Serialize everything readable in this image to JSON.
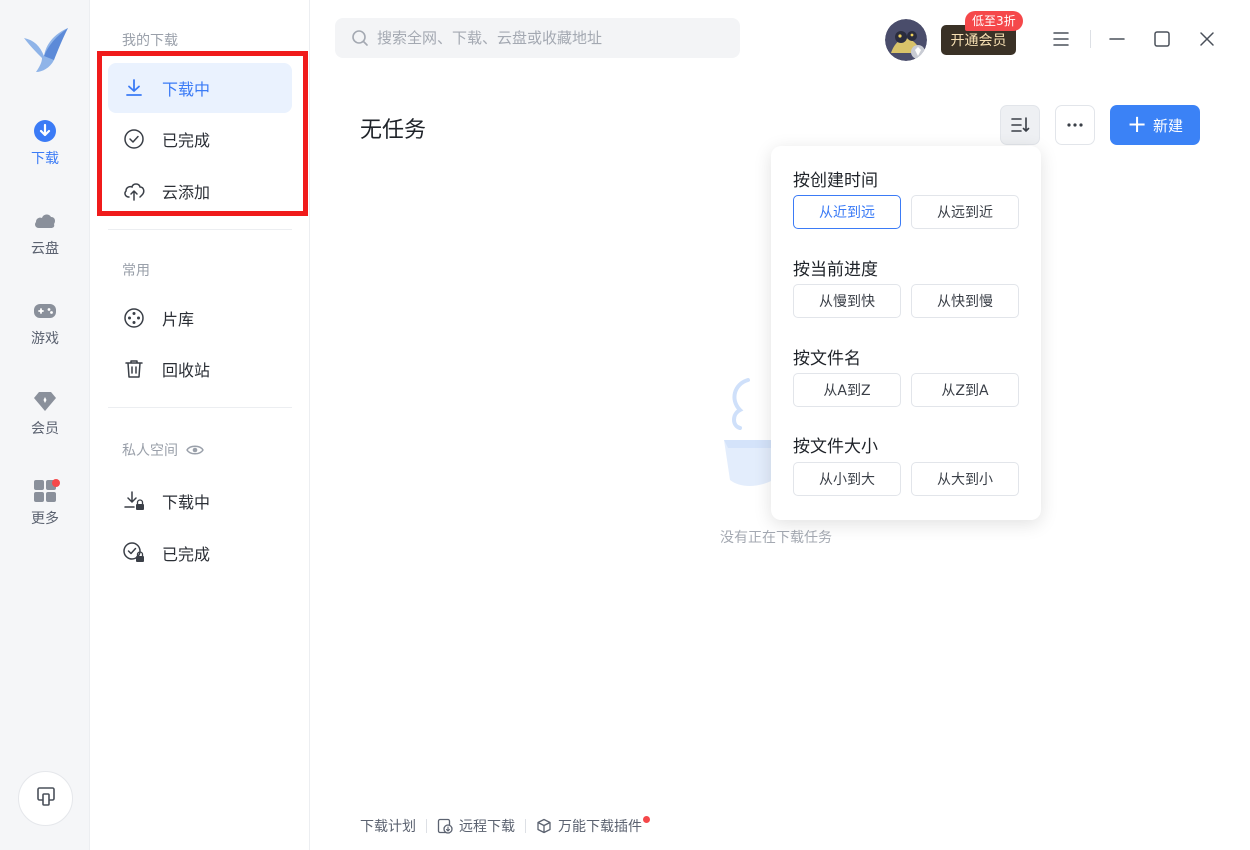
{
  "rail": {
    "items": [
      {
        "label": "下载",
        "icon": "download-circle-icon",
        "active": true
      },
      {
        "label": "云盘",
        "icon": "cloud-icon"
      },
      {
        "label": "游戏",
        "icon": "gamepad-icon"
      },
      {
        "label": "会员",
        "icon": "diamond-icon"
      },
      {
        "label": "更多",
        "icon": "apps-grid-icon"
      }
    ]
  },
  "sidebar": {
    "my_downloads_heading": "我的下载",
    "my_downloads": [
      {
        "label": "下载中",
        "icon": "download-arrow-icon"
      },
      {
        "label": "已完成",
        "icon": "check-circle-icon"
      },
      {
        "label": "云添加",
        "icon": "cloud-upload-icon"
      }
    ],
    "common_heading": "常用",
    "common": [
      {
        "label": "片库",
        "icon": "film-reel-icon"
      },
      {
        "label": "回收站",
        "icon": "trash-icon"
      }
    ],
    "private_heading": "私人空间",
    "private": [
      {
        "label": "下载中",
        "icon": "download-lock-icon"
      },
      {
        "label": "已完成",
        "icon": "check-lock-icon"
      }
    ]
  },
  "topbar": {
    "search_placeholder": "搜索全网、下载、云盘或收藏地址",
    "vip_button": "开通会员",
    "vip_badge": "低至3折"
  },
  "main": {
    "title": "无任务",
    "new_button": "新建",
    "empty_text": "没有正在下载任务"
  },
  "sort_menu": {
    "groups": [
      {
        "title": "按创建时间",
        "options": [
          "从近到远",
          "从远到近"
        ],
        "selected": 0
      },
      {
        "title": "按当前进度",
        "options": [
          "从慢到快",
          "从快到慢"
        ]
      },
      {
        "title": "按文件名",
        "options": [
          "从A到Z",
          "从Z到A"
        ]
      },
      {
        "title": "按文件大小",
        "options": [
          "从小到大",
          "从大到小"
        ]
      }
    ]
  },
  "footer": {
    "items": [
      "下载计划",
      "远程下载",
      "万能下载插件"
    ]
  },
  "colors": {
    "accent": "#3b7bf6",
    "highlight_box": "#f01b1b",
    "badge_red": "#f5484a"
  }
}
